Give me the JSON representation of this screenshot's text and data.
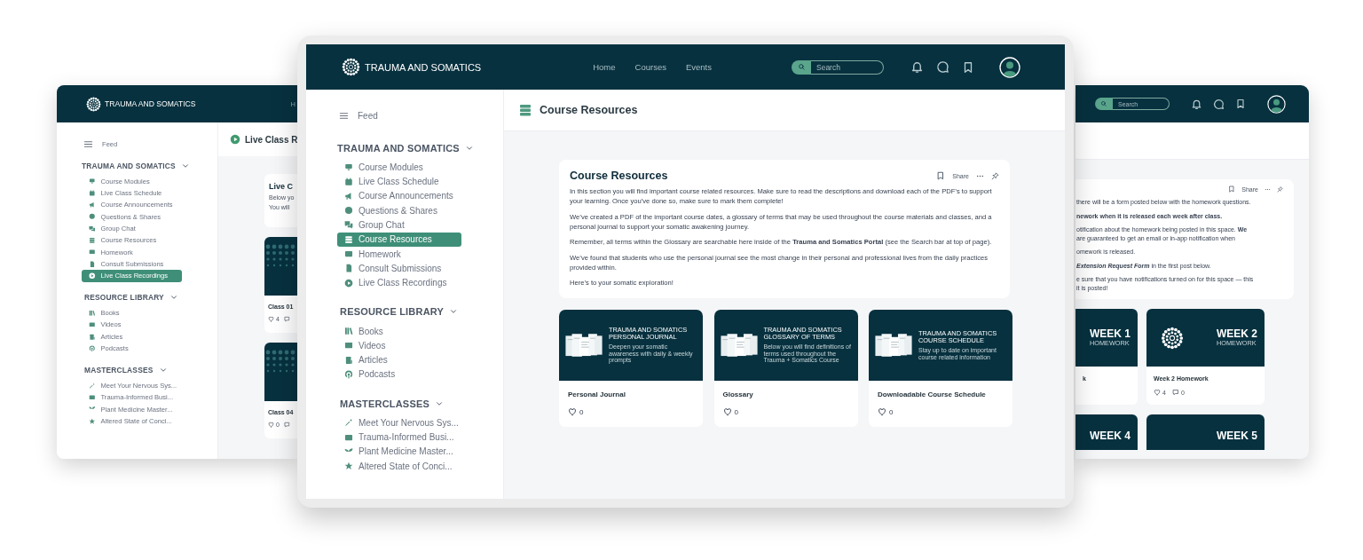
{
  "back_left": {
    "brand": "TRAUMA AND SOMATICS",
    "nav": [
      {
        "label": "H"
      }
    ],
    "sidebar": {
      "feed": "Feed",
      "groups": [
        {
          "title": "TRAUMA AND SOMATICS",
          "expanded": true,
          "items": [
            {
              "label": "Course Modules",
              "selected": false
            },
            {
              "label": "Live Class Schedule",
              "selected": false
            },
            {
              "label": "Course Announcements",
              "selected": false
            },
            {
              "label": "Questions & Shares",
              "selected": false
            },
            {
              "label": "Group Chat",
              "selected": false
            },
            {
              "label": "Course Resources",
              "selected": false
            },
            {
              "label": "Homework",
              "selected": false
            },
            {
              "label": "Consult Submissions",
              "selected": false
            },
            {
              "label": "Live Class Recordings",
              "selected": true
            }
          ]
        },
        {
          "title": "RESOURCE LIBRARY",
          "expanded": true,
          "items": [
            {
              "label": "Books",
              "selected": false
            },
            {
              "label": "Videos",
              "selected": false
            },
            {
              "label": "Articles",
              "selected": false
            },
            {
              "label": "Podcasts",
              "selected": false
            }
          ]
        },
        {
          "title": "MASTERCLASSES",
          "expanded": true,
          "items": [
            {
              "label": "Meet Your Nervous Sys...",
              "selected": false
            },
            {
              "label": "Trauma-Informed Busi...",
              "selected": false
            },
            {
              "label": "Plant Medicine Master...",
              "selected": false
            },
            {
              "label": "Altered State of Conci...",
              "selected": false
            }
          ]
        }
      ]
    },
    "page_title": "Live Class R",
    "post": {
      "title": "Live C",
      "lines": [
        "Below yo",
        "You will"
      ]
    },
    "recordings": [
      {
        "title": "Class 01",
        "likes": "4"
      },
      {
        "title": "Class 04",
        "likes": "0"
      }
    ]
  },
  "front": {
    "brand": "TRAUMA AND SOMATICS",
    "nav": [
      {
        "label": "Home"
      },
      {
        "label": "Courses"
      },
      {
        "label": "Events"
      }
    ],
    "search": {
      "placeholder": "Search"
    },
    "sidebar": {
      "feed": "Feed",
      "groups": [
        {
          "title": "TRAUMA AND SOMATICS",
          "expanded": true,
          "items": [
            {
              "label": "Course Modules",
              "selected": false
            },
            {
              "label": "Live Class Schedule",
              "selected": false
            },
            {
              "label": "Course Announcements",
              "selected": false
            },
            {
              "label": "Questions & Shares",
              "selected": false
            },
            {
              "label": "Group Chat",
              "selected": false
            },
            {
              "label": "Course Resources",
              "selected": true
            },
            {
              "label": "Homework",
              "selected": false
            },
            {
              "label": "Consult Submissions",
              "selected": false
            },
            {
              "label": "Live Class Recordings",
              "selected": false
            }
          ]
        },
        {
          "title": "RESOURCE LIBRARY",
          "expanded": true,
          "items": [
            {
              "label": "Books",
              "selected": false
            },
            {
              "label": "Videos",
              "selected": false
            },
            {
              "label": "Articles",
              "selected": false
            },
            {
              "label": "Podcasts",
              "selected": false
            }
          ]
        },
        {
          "title": "MASTERCLASSES",
          "expanded": true,
          "items": [
            {
              "label": "Meet Your Nervous Sys...",
              "selected": false
            },
            {
              "label": "Trauma-Informed Busi...",
              "selected": false
            },
            {
              "label": "Plant Medicine Master...",
              "selected": false
            },
            {
              "label": "Altered State of Conci...",
              "selected": false
            }
          ]
        }
      ]
    },
    "page_title": "Course Resources",
    "post": {
      "title": "Course Resources",
      "share": "Share",
      "paragraphs": [
        "In this section you will find important course related resources. Make sure to read the descriptions and download each of the PDF’s to support your learning. Once you’ve done so, make sure to mark them complete!",
        "We’ve created a PDF of the important course dates, a glossary of terms that may be used throughout the course materials and classes, and a personal journal to support your somatic awakening journey.",
        "Remember, all terms within the Glossary are searchable here inside of the **Trauma and Somatics Portal** (see the Search bar at top of page).",
        "We’ve found that students who use the personal journal see the most change in their personal and professional lives from the daily practices provided within.",
        "Here’s to your somatic exploration!"
      ]
    },
    "resources": [
      {
        "thumb_title": "TRAUMA AND SOMATICS PERSONAL JOURNAL",
        "thumb_subtitle": "Deepen your somatic awareness with daily & weekly prompts",
        "title": "Personal Journal",
        "likes": "0"
      },
      {
        "thumb_title": "TRAUMA AND SOMATICS GLOSSARY OF TERMS",
        "thumb_subtitle": "Below you will find definitions of terms used throughout the Trauma + Somatics Course",
        "title": "Glossary",
        "likes": "0"
      },
      {
        "thumb_title": "TRAUMA AND SOMATICS COURSE SCHEDULE",
        "thumb_subtitle": "Stay up to date on important course related information",
        "title": "Downloadable Course Schedule",
        "likes": "0"
      }
    ]
  },
  "back_right": {
    "search": {
      "placeholder": "Search"
    },
    "post": {
      "share": "Share",
      "paragraphs": [
        {
          "bold": false,
          "lines": [
            "there will be a form posted below with the homework questions."
          ]
        },
        {
          "bold": true,
          "lines": [
            "nework when it is released each week after class."
          ]
        },
        {
          "bold": false,
          "lines": [
            "otification about the homework being posted in this space. **We**",
            "are guaranteed to get an email or in-app notification when"
          ]
        },
        {
          "bold": false,
          "lines": [
            "omework is released."
          ]
        },
        {
          "bold": false,
          "lines": [
            "*Extension Request Form* in the first post below."
          ]
        },
        {
          "bold": false,
          "lines": [
            "e sure that you have notifications turned on for this space — this",
            "it is posted!"
          ]
        }
      ]
    },
    "homework": [
      {
        "thumb_title": "WEEK 1",
        "thumb_subtitle": "HOMEWORK",
        "title": "k"
      },
      {
        "thumb_title": "WEEK 2",
        "thumb_subtitle": "HOMEWORK",
        "title": "Week 2 Homework",
        "likes": "4",
        "comments": "0"
      }
    ],
    "more_homework": [
      {
        "thumb_title": "WEEK 4"
      },
      {
        "thumb_title": "WEEK 5"
      }
    ]
  }
}
